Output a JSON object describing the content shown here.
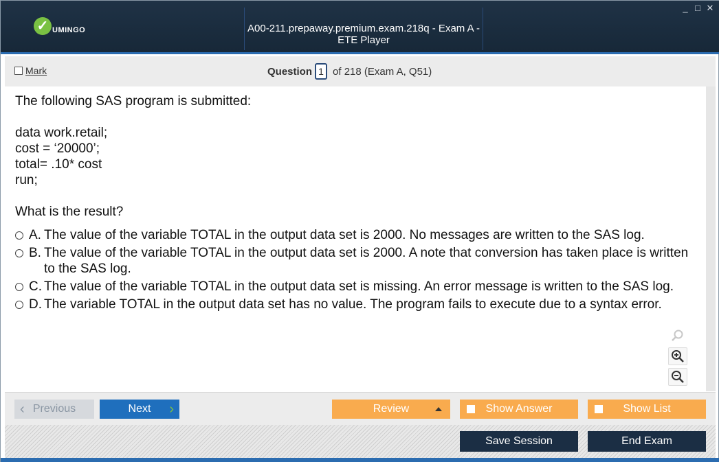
{
  "window": {
    "title": "A00-211.prepaway.premium.exam.218q - Exam A - ETE Player",
    "controls": {
      "minimize": "_",
      "maximize": "□",
      "close": "✕"
    }
  },
  "logo": {
    "badge": "✓",
    "text": "UMINGO"
  },
  "question_bar": {
    "mark_label": "Mark",
    "question_label": "Question",
    "question_number": "1",
    "question_suffix": "of 218 (Exam A, Q51)"
  },
  "content": {
    "intro": "The following SAS program is submitted:",
    "code_lines": [
      "data work.retail;",
      "cost = ‘20000’;",
      "total= .10* cost",
      "run;"
    ],
    "question": "What is the result?",
    "options": [
      {
        "letter": "A.",
        "text": "The value of the variable TOTAL in the output data set is 2000. No messages are written to the SAS log."
      },
      {
        "letter": "B.",
        "text": "The value of the variable TOTAL in the output data set is 2000. A note that conversion has taken place is written to the SAS log."
      },
      {
        "letter": "C.",
        "text": "The value of the variable TOTAL in the output data set is missing. An error message is written to the SAS log."
      },
      {
        "letter": "D.",
        "text": "The variable TOTAL in the output data set has no value. The program fails to execute due to a syntax error."
      }
    ]
  },
  "tools": {
    "search_icon": "search-icon",
    "zoom_in_icon": "zoom-in-icon",
    "zoom_out_icon": "zoom-out-icon"
  },
  "nav": {
    "previous": "Previous",
    "next": "Next",
    "review": "Review",
    "show_answer": "Show Answer",
    "show_list": "Show List"
  },
  "footer": {
    "save_session": "Save Session",
    "end_exam": "End Exam"
  },
  "colors": {
    "titlebar": "#1f3246",
    "accent_blue": "#1f6fbd",
    "orange": "#f9ab4e",
    "dark_button": "#1b2e44",
    "logo_green": "#7ac143"
  }
}
